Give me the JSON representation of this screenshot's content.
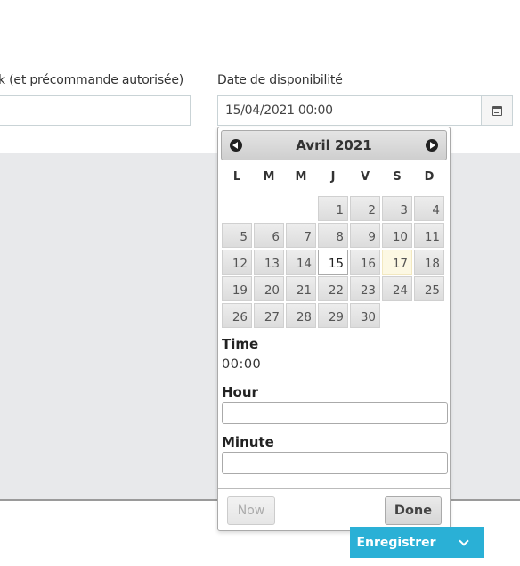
{
  "form": {
    "left_label": "k (et précommande autorisée)",
    "left_value": "",
    "date_label": "Date de disponibilité",
    "date_value": "15/04/2021 00:00"
  },
  "datepicker": {
    "month_title": "Avril 2021",
    "weekdays": [
      "L",
      "M",
      "M",
      "J",
      "V",
      "S",
      "D"
    ],
    "weeks": [
      [
        "",
        "",
        "",
        "1",
        "2",
        "3",
        "4"
      ],
      [
        "5",
        "6",
        "7",
        "8",
        "9",
        "10",
        "11"
      ],
      [
        "12",
        "13",
        "14",
        "15",
        "16",
        "17",
        "18"
      ],
      [
        "19",
        "20",
        "21",
        "22",
        "23",
        "24",
        "25"
      ],
      [
        "26",
        "27",
        "28",
        "29",
        "30",
        "",
        ""
      ]
    ],
    "selected_day": "15",
    "highlighted_day": "17",
    "time_label": "Time",
    "time_value": "00:00",
    "hour_label": "Hour",
    "minute_label": "Minute",
    "now_label": "Now",
    "done_label": "Done"
  },
  "footer": {
    "save_label": "Enregistrer"
  },
  "colors": {
    "accent": "#2ab0d6",
    "gray_area": "#e8e9eb",
    "highlight_day": "#fcf8e3"
  },
  "icons": {
    "calendar": "calendar-icon",
    "prev": "chevron-left-circle-icon",
    "next": "chevron-right-circle-icon",
    "dropdown": "chevron-down-icon"
  }
}
